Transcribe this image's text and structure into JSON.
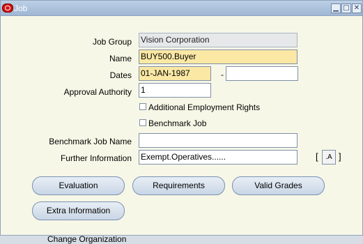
{
  "window": {
    "title": "Job"
  },
  "titlebar_buttons": {
    "minimize": "▁",
    "maximize": "□",
    "close": "✕"
  },
  "form": {
    "job_group_label": "Job Group",
    "job_group_value": "Vision Corporation",
    "name_label": "Name",
    "name_value": "BUY500.Buyer",
    "dates_label": "Dates",
    "date_from": "01-JAN-1987",
    "date_separator": "-",
    "date_to": "",
    "approval_label": "Approval Authority",
    "approval_value": "1",
    "additional_rights_label": "Additional Employment Rights",
    "benchmark_job_label": "Benchmark Job",
    "benchmark_job_name_label": "Benchmark Job Name",
    "benchmark_job_name_value": "",
    "further_info_label": "Further Information",
    "further_info_value": "Exempt.Operatives......",
    "flex_bracket_open": "[",
    "flex_bracket_close": "]",
    "flex_button": ".A"
  },
  "buttons": {
    "evaluation": "Evaluation",
    "requirements": "Requirements",
    "valid_grades": "Valid Grades",
    "extra_information": "Extra Information"
  },
  "background": {
    "behind_text": "Change Organization"
  }
}
